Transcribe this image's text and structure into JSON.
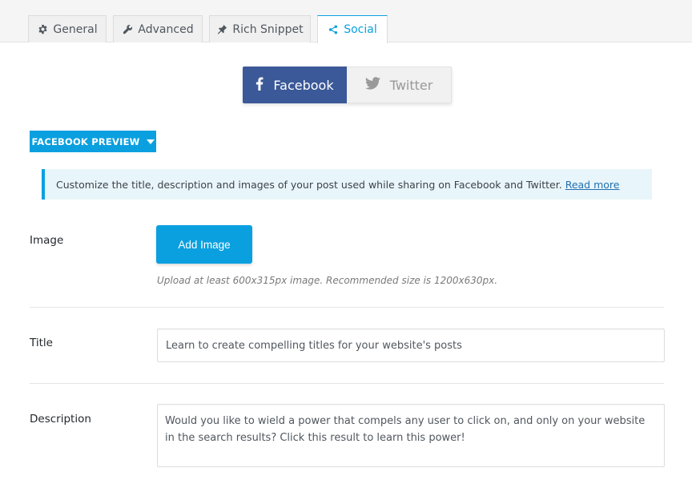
{
  "tabs": [
    {
      "label": "General",
      "icon": "gear-icon"
    },
    {
      "label": "Advanced",
      "icon": "wrench-icon"
    },
    {
      "label": "Rich Snippet",
      "icon": "pin-icon"
    },
    {
      "label": "Social",
      "icon": "share-icon",
      "active": true
    }
  ],
  "network": {
    "facebook_label": "Facebook",
    "twitter_label": "Twitter",
    "active": "facebook"
  },
  "preview_toggle": {
    "label": "FACEBOOK PREVIEW"
  },
  "notice": {
    "text": "Customize the title, description and images of your post used while sharing on Facebook and Twitter.",
    "link": "Read more"
  },
  "image": {
    "label": "Image",
    "button": "Add Image",
    "hint": "Upload at least 600x315px image. Recommended size is 1200x630px."
  },
  "title": {
    "label": "Title",
    "value": "Learn to create compelling titles for your website's posts"
  },
  "description": {
    "label": "Description",
    "value": "Would you like to wield a power that compels any user to click on, and only on your website in the search results? Click this result to learn this power!"
  },
  "colors": {
    "accent": "#0aa0e0",
    "facebook": "#3b5998",
    "notice_bg": "#e8f5fa"
  }
}
